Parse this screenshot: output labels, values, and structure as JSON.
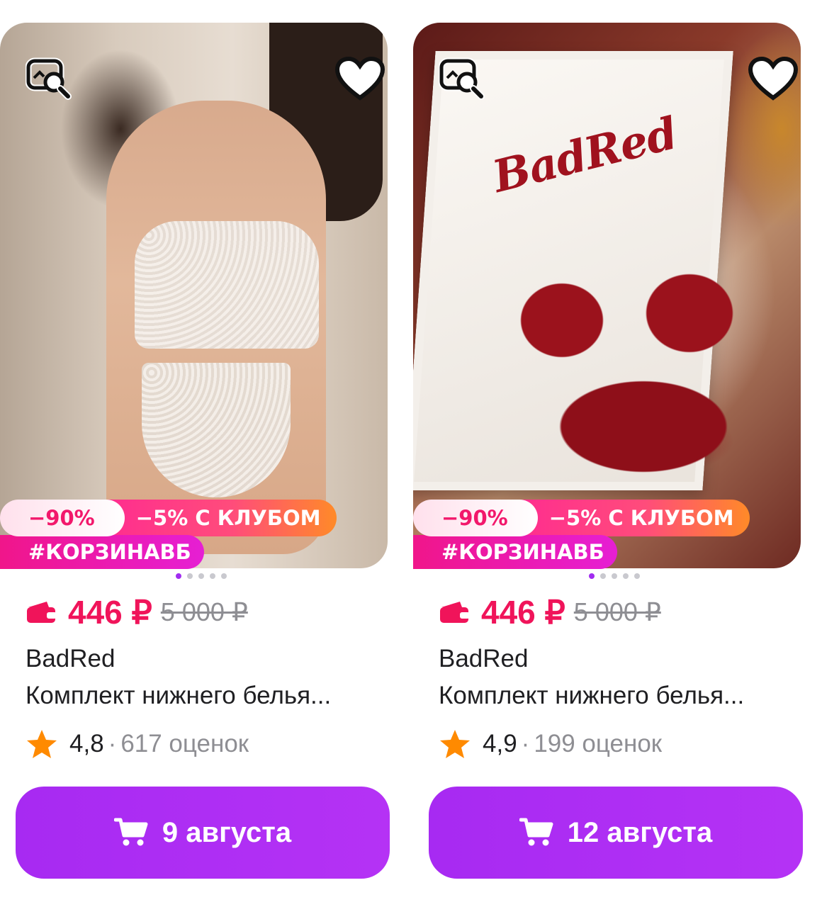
{
  "colors": {
    "price": "#f0145a",
    "button": "#a72af2",
    "discount_text": "#f2186b",
    "star": "#ff8a00"
  },
  "products": [
    {
      "badges": {
        "discount": "−90%",
        "club": "−5% С КЛУБОМ",
        "tag": "#КОРЗИНАВБ"
      },
      "price": "446 ₽",
      "old_price": "5 000 ₽",
      "brand": "BadRed",
      "title": "Комплект нижнего белья...",
      "rating": "4,8",
      "separator": "·",
      "reviews": "617 оценок",
      "delivery_label": "9 августа",
      "carousel": {
        "total": 5,
        "active": 0
      }
    },
    {
      "badges": {
        "discount": "−90%",
        "club": "−5% С КЛУБОМ",
        "tag": "#КОРЗИНАВБ"
      },
      "price": "446 ₽",
      "old_price": "5 000 ₽",
      "brand": "BadRed",
      "title": "Комплект нижнего белья...",
      "rating": "4,9",
      "separator": "·",
      "reviews": "199 оценок",
      "delivery_label": "12 августа",
      "carousel": {
        "total": 5,
        "active": 0
      },
      "image_text": "BadRed"
    }
  ]
}
